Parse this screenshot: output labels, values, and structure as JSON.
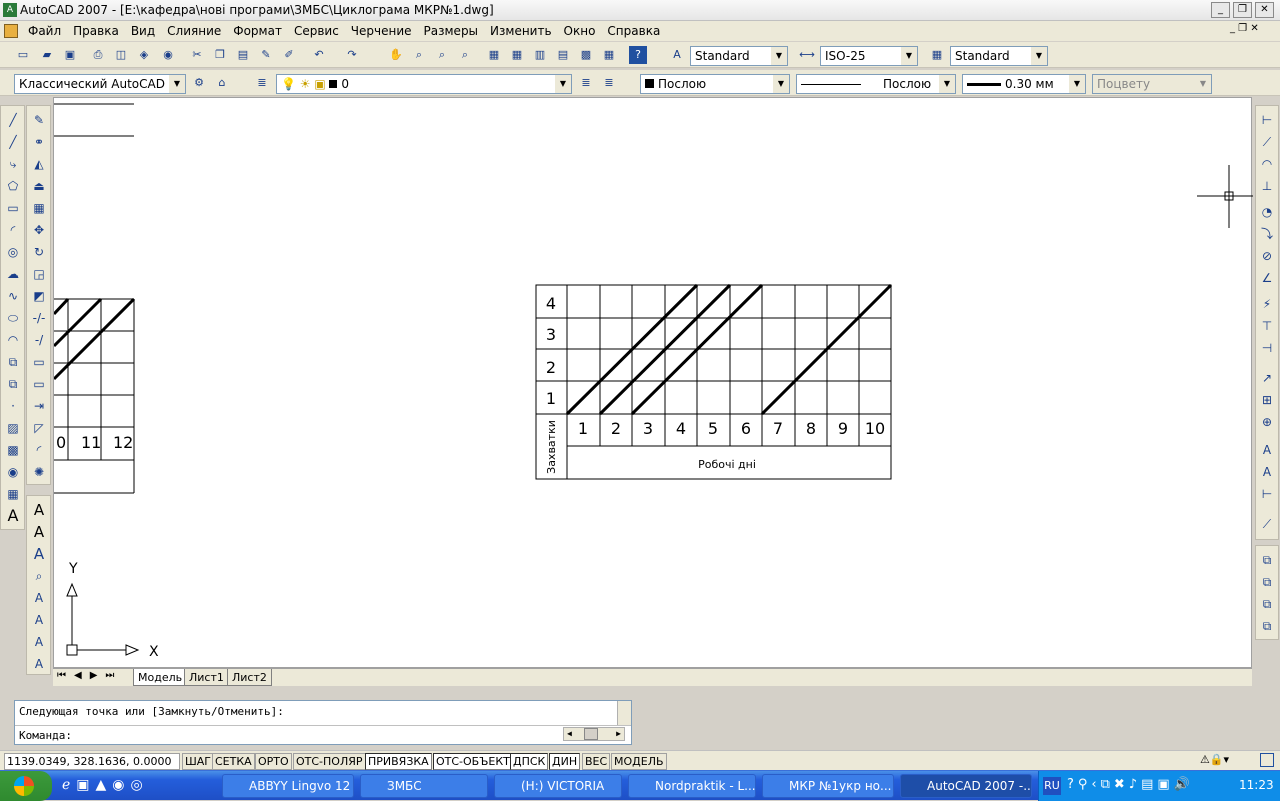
{
  "title": "AutoCAD 2007 - [E:\\кафедра\\нові програми\\ЗМБС\\Циклограма МКР№1.dwg]",
  "menu": [
    "Файл",
    "Правка",
    "Вид",
    "Слияние",
    "Формат",
    "Сервис",
    "Черчение",
    "Размеры",
    "Изменить",
    "Окно",
    "Справка"
  ],
  "styles": {
    "text_style": "Standard",
    "dim_style": "ISO-25",
    "table_style": "Standard"
  },
  "workspace": "Классический AutoCAD",
  "layer": "0",
  "props": {
    "color": "Послою",
    "linetype": "Послою",
    "lineweight": "0.30 мм",
    "plotstyle": "Поцвету"
  },
  "drawing": {
    "y_labels": [
      "4",
      "3",
      "2",
      "1"
    ],
    "y_axis_title": "Захватки",
    "x_labels": [
      "1",
      "2",
      "3",
      "4",
      "5",
      "6",
      "7",
      "8",
      "9",
      "10"
    ],
    "x_axis_title": "Робочі дні",
    "left_x_labels": [
      "0",
      "11",
      "12"
    ],
    "ucs_x": "X",
    "ucs_y": "Y"
  },
  "tabs": [
    "Модель",
    "Лист1",
    "Лист2"
  ],
  "command": {
    "line1": "Следующая точка или [Замкнуть/Отменить]:",
    "line2": "Команда:"
  },
  "status": {
    "coords": "1139.0349, 328.1636, 0.0000",
    "buttons": [
      "ШАГ",
      "СЕТКА",
      "ОРТО",
      "ОТС-ПОЛЯР",
      "ПРИВЯЗКА",
      "ОТС-ОБЪЕКТ",
      "ДПСК",
      "ДИН",
      "ВЕС",
      "МОДЕЛЬ"
    ]
  },
  "taskbar": {
    "items": [
      "ABBYY Lingvo 12",
      "ЗМБС",
      "(H:) VICTORIA",
      "Nordpraktik - L...",
      "МКР №1укр но...",
      "AutoCAD 2007 -..."
    ],
    "lang": "RU",
    "clock": "11:23"
  }
}
